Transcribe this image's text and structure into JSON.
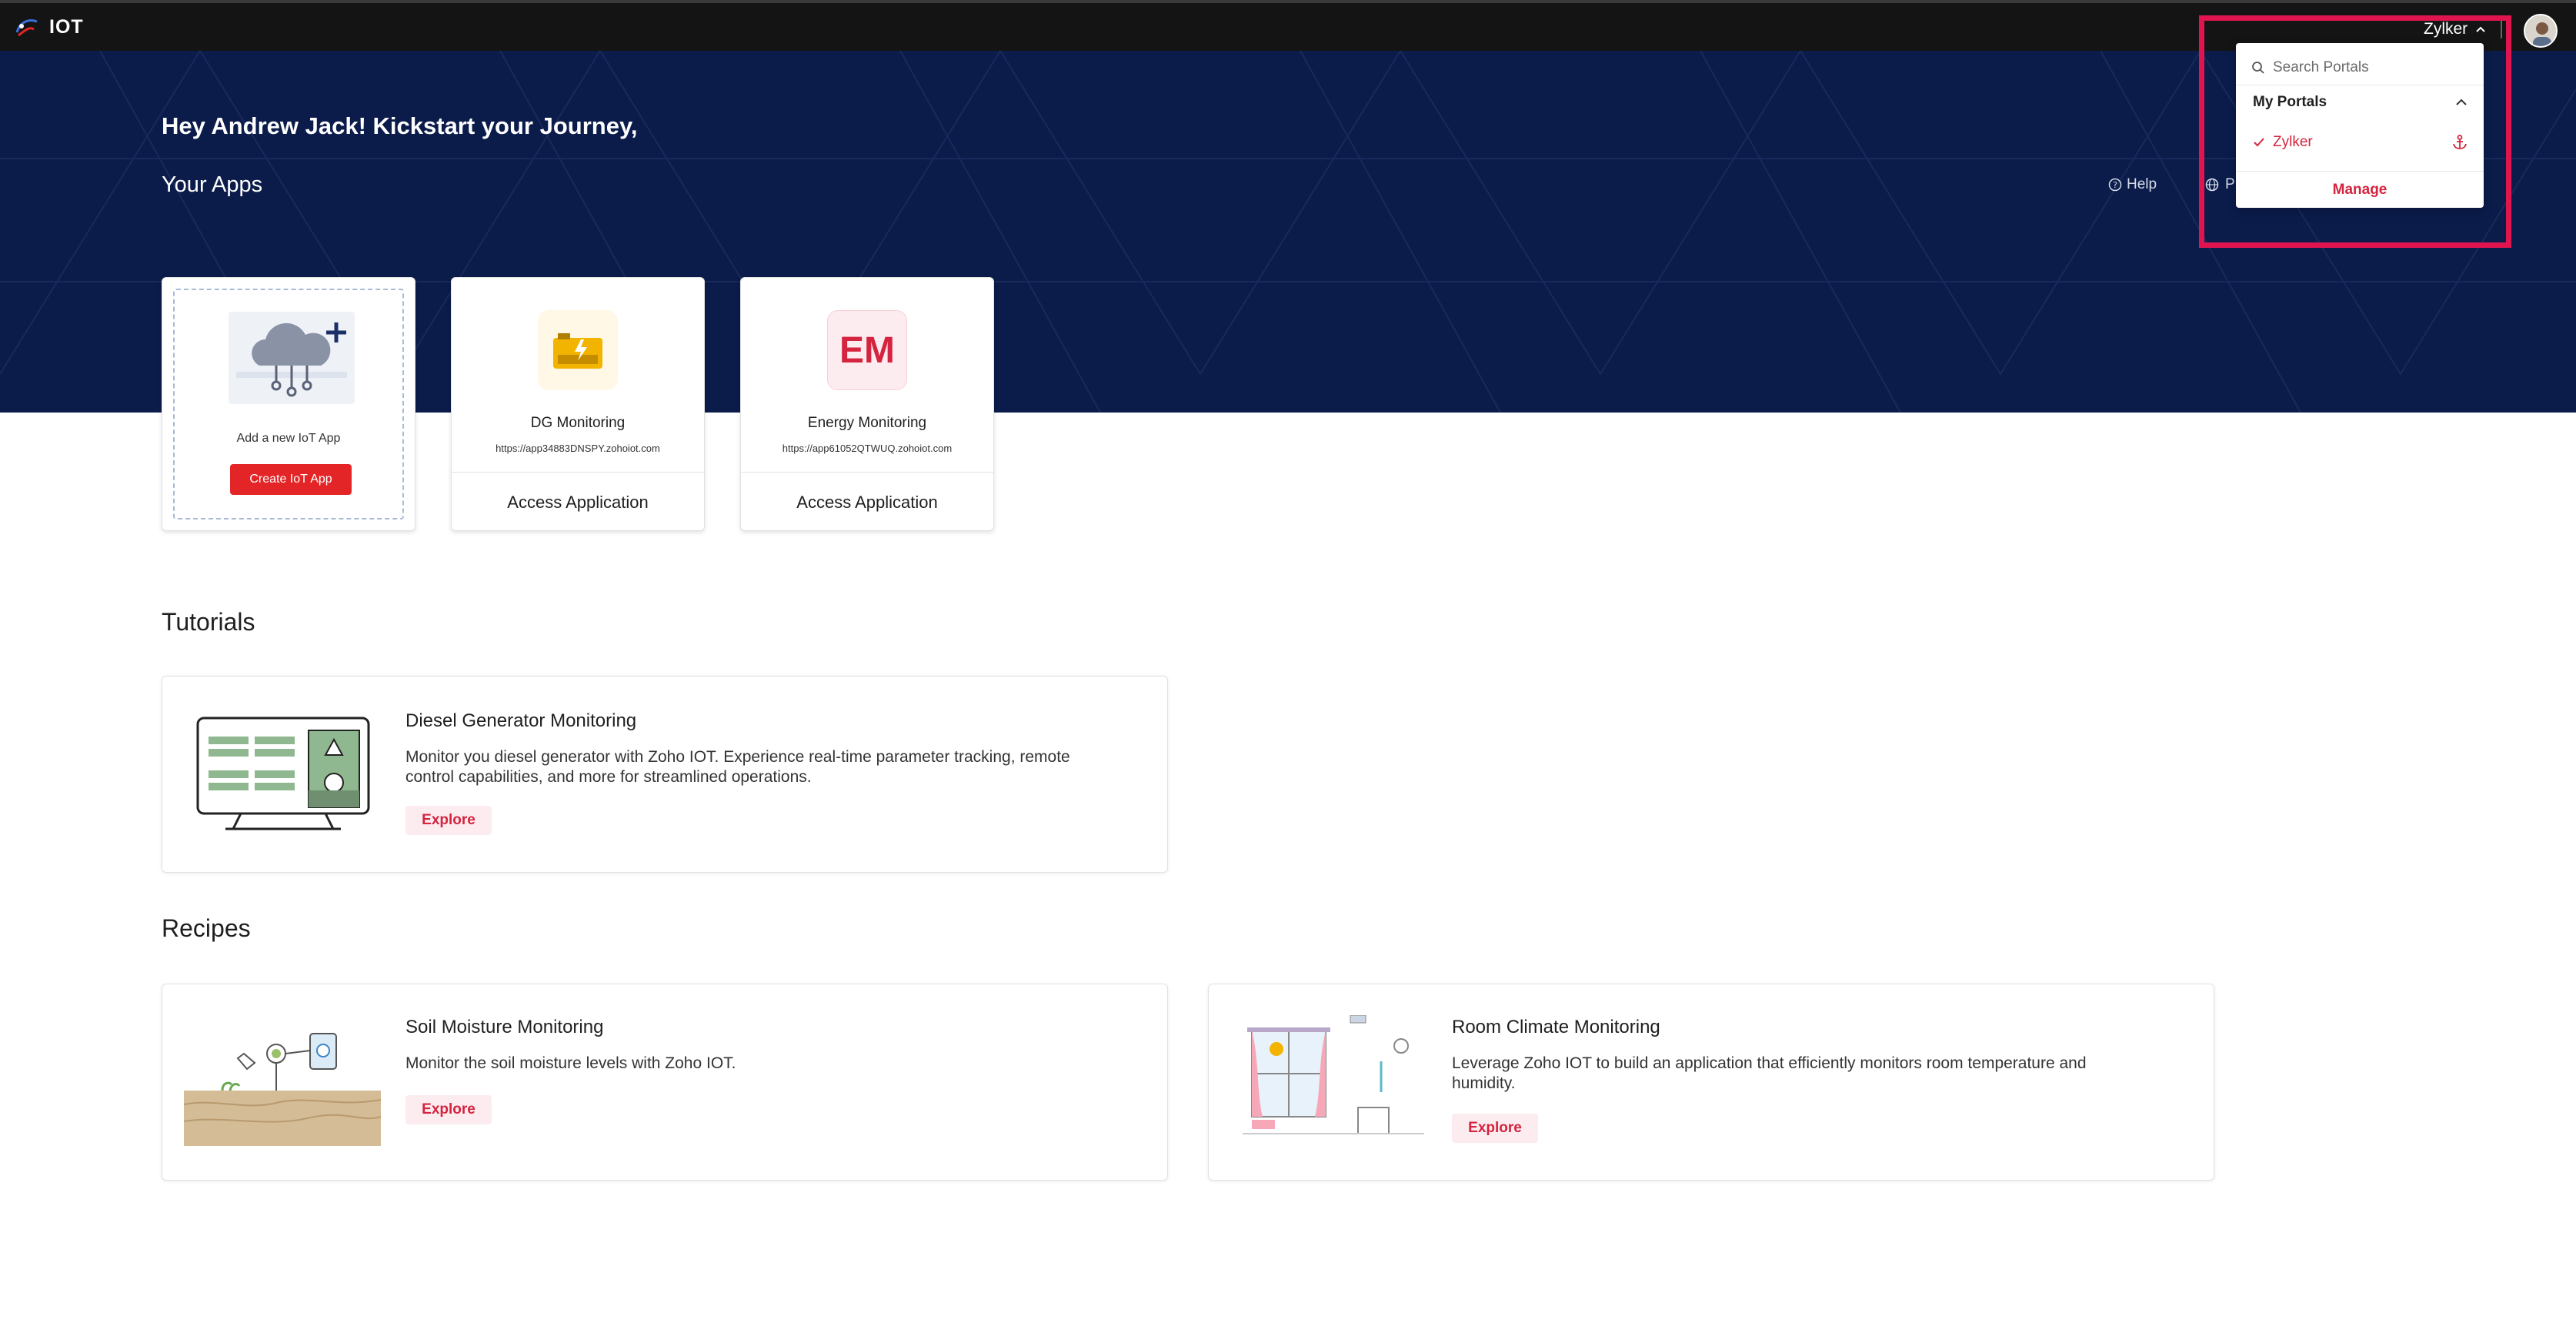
{
  "topbar": {
    "app_name": "IOT",
    "portal_name": "Zylker"
  },
  "hero": {
    "greeting": "Hey Andrew Jack! Kickstart your Journey,",
    "your_apps": "Your Apps",
    "help": "Help",
    "globe_link_partial": "P"
  },
  "apps": {
    "add_label": "Add a new IoT App",
    "create_button": "Create IoT App",
    "items": [
      {
        "name": "DG Monitoring",
        "url": "https://app34883DNSPY.zohoiot.com",
        "action": "Access Application"
      },
      {
        "name": "Energy Monitoring",
        "url": "https://app61052QTWUQ.zohoiot.com",
        "action": "Access Application",
        "icon_text": "EM"
      }
    ]
  },
  "tutorials": {
    "title": "Tutorials",
    "items": [
      {
        "title": "Diesel Generator Monitoring",
        "desc_line1": "Monitor you diesel generator with Zoho IOT. Experience real-time parameter tracking, remote",
        "desc_line2": "control capabilities, and more for streamlined operations.",
        "action": "Explore"
      }
    ]
  },
  "recipes": {
    "title": "Recipes",
    "items": [
      {
        "title": "Soil Moisture Monitoring",
        "desc_line1": "Monitor the soil moisture levels with Zoho IOT.",
        "action": "Explore"
      },
      {
        "title": "Room Climate Monitoring",
        "desc_line1": "Leverage Zoho IOT to build an application that efficiently monitors room temperature and",
        "desc_line2": "humidity.",
        "action": "Explore"
      }
    ]
  },
  "portal_dropdown": {
    "search_placeholder": "Search Portals",
    "heading": "My Portals",
    "items": [
      {
        "label": "Zylker",
        "selected": true
      }
    ],
    "manage": "Manage"
  },
  "colors": {
    "accent": "#e42527",
    "hero_bg": "#0b1c4b",
    "topbar_bg": "#141414",
    "highlight": "#e0154f"
  }
}
